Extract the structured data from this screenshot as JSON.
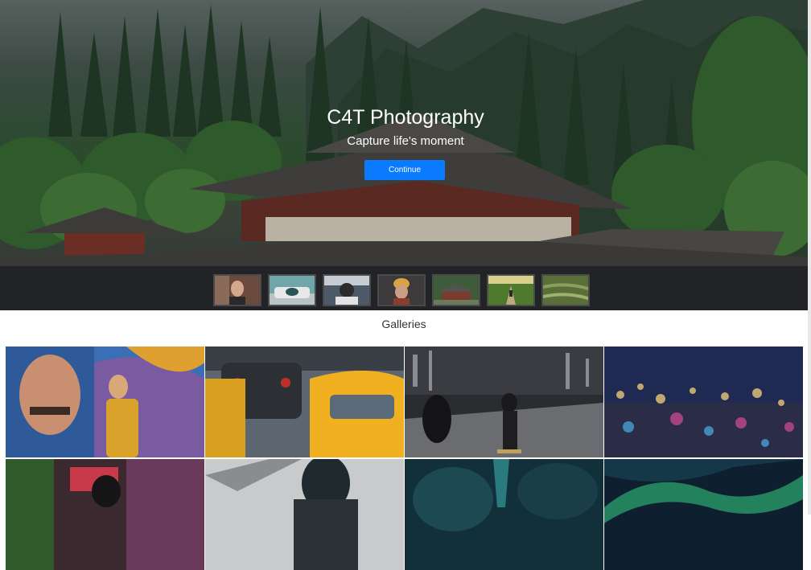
{
  "hero": {
    "title": "C4T Photography",
    "subtitle": "Capture life's moment",
    "button_label": "Continue",
    "button_color": "#0a7bff"
  },
  "thumbnails": [
    {
      "name": "portrait-man"
    },
    {
      "name": "vintage-car"
    },
    {
      "name": "street-camera"
    },
    {
      "name": "woman-beanie"
    },
    {
      "name": "temple"
    },
    {
      "name": "forest-path"
    },
    {
      "name": "rice-terraces"
    }
  ],
  "galleries": {
    "title": "Galleries",
    "tiles": [
      {
        "name": "street-mural-woman"
      },
      {
        "name": "taxi-traffic"
      },
      {
        "name": "night-skateboarder"
      },
      {
        "name": "city-bokeh"
      },
      {
        "name": "neon-silhouette"
      },
      {
        "name": "rooftop-figure"
      },
      {
        "name": "cave-rocks"
      },
      {
        "name": "aurora-sky"
      }
    ]
  },
  "colors": {
    "strip_bg": "#222327",
    "page_bg": "#ffffff"
  }
}
